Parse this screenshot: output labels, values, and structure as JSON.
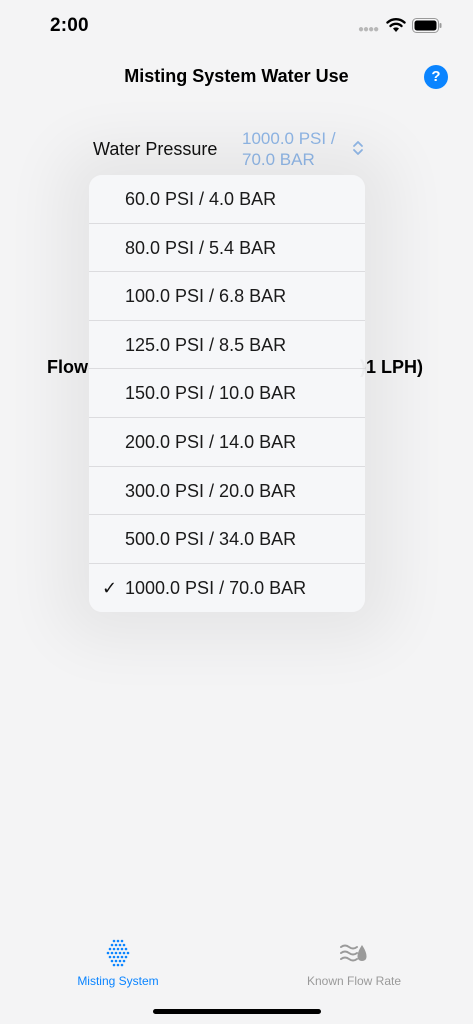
{
  "status_bar": {
    "time": "2:00"
  },
  "nav": {
    "title": "Misting System Water Use",
    "help_label": "?"
  },
  "pressure": {
    "label": "Water Pressure",
    "value_line1": "1000.0 PSI /",
    "value_line2": "70.0 BAR"
  },
  "background": {
    "flow_left": "Flow",
    "flow_right": ")1 LPH)"
  },
  "menu": {
    "items": [
      {
        "label": "60.0 PSI / 4.0 BAR",
        "selected": false
      },
      {
        "label": "80.0 PSI / 5.4 BAR",
        "selected": false
      },
      {
        "label": "100.0 PSI / 6.8 BAR",
        "selected": false
      },
      {
        "label": "125.0 PSI / 8.5 BAR",
        "selected": false
      },
      {
        "label": "150.0 PSI / 10.0 BAR",
        "selected": false
      },
      {
        "label": "200.0 PSI / 14.0 BAR",
        "selected": false
      },
      {
        "label": "300.0 PSI / 20.0 BAR",
        "selected": false
      },
      {
        "label": "500.0 PSI / 34.0 BAR",
        "selected": false
      },
      {
        "label": "1000.0 PSI / 70.0 BAR",
        "selected": true
      }
    ],
    "check_glyph": "✓"
  },
  "tabs": {
    "misting": {
      "label": "Misting System",
      "icon": "spray-dots-icon",
      "active": true
    },
    "known": {
      "label": "Known Flow Rate",
      "icon": "water-flow-drop-icon",
      "active": false
    }
  },
  "colors": {
    "accent": "#0a84ff",
    "inactive": "#9a9a9a",
    "picker_value": "#8fb6e6"
  }
}
